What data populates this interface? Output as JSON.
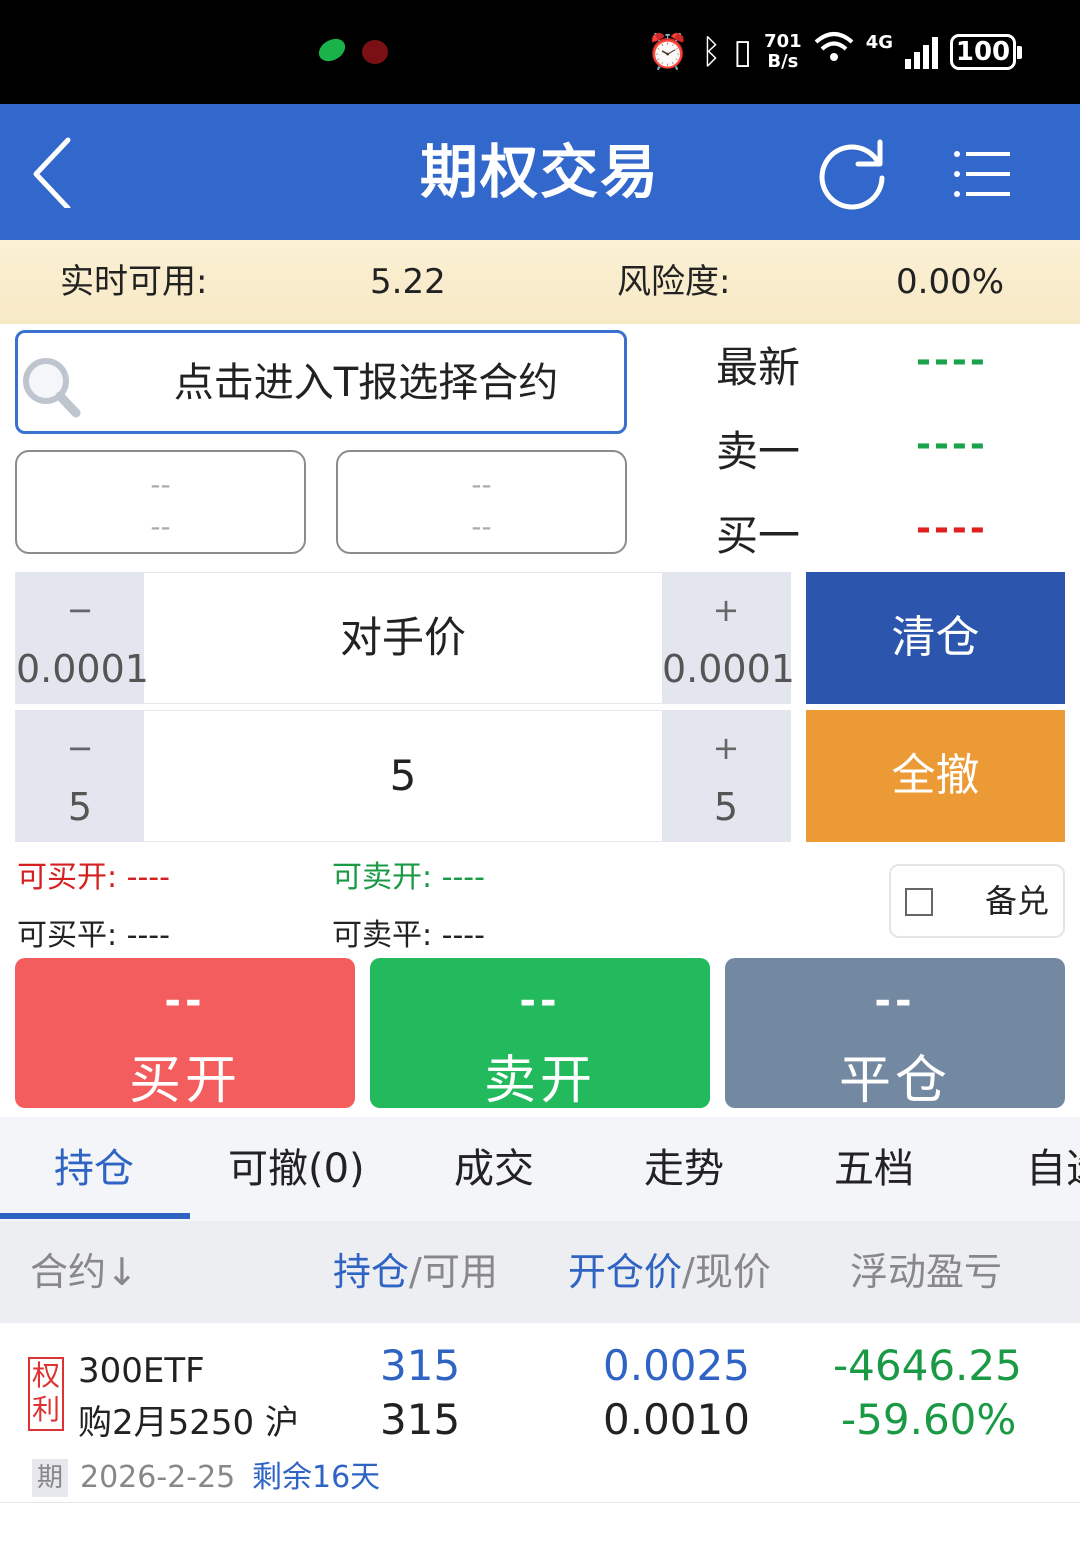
{
  "status_bar": {
    "net_speed_value": "701",
    "net_speed_unit": "B/s",
    "network_type": "4G",
    "battery": "100"
  },
  "header": {
    "title": "期权交易"
  },
  "account": {
    "available_label": "实时可用:",
    "available_value": "5.22",
    "risk_label": "风险度:",
    "risk_value": "0.00%"
  },
  "contract_search": {
    "label": "点击进入T报选择合约"
  },
  "dropdowns": [
    {
      "line1": "--",
      "line2": "--"
    },
    {
      "line1": "--",
      "line2": "--"
    }
  ],
  "quotes": [
    {
      "label": "最新",
      "value": "----",
      "color": "#1aa34a"
    },
    {
      "label": "卖一",
      "value": "----",
      "color": "#1aa34a"
    },
    {
      "label": "买一",
      "value": "----",
      "color": "#e02020"
    }
  ],
  "price_stepper": {
    "minus_sign": "−",
    "minus_amount": "0.0001",
    "center": "对手价",
    "plus_sign": "+",
    "plus_amount": "0.0001"
  },
  "qty_stepper": {
    "minus_sign": "−",
    "minus_amount": "5",
    "center": "5",
    "plus_sign": "+",
    "plus_amount": "5"
  },
  "actions": {
    "close_all": "清仓",
    "cancel_all": "全撤"
  },
  "availability": {
    "buy_open": "可买开: ----",
    "sell_open": "可卖开: ----",
    "buy_close": "可买平: ----",
    "sell_close": "可卖平: ----"
  },
  "covered": {
    "label": "备兑",
    "checked": false
  },
  "trade_buttons": [
    {
      "price": "--",
      "label": "买开",
      "color": "#f45d5d"
    },
    {
      "price": "--",
      "label": "卖开",
      "color": "#22ba5d"
    },
    {
      "price": "--",
      "label": "平仓",
      "color": "#7389a1"
    }
  ],
  "tabs": [
    "持仓",
    "可撤(0)",
    "成交",
    "走势",
    "五档",
    "自选"
  ],
  "active_tab": "持仓",
  "table_header": {
    "contract": "合约↓",
    "position_a": "持仓",
    "position_b": "/可用",
    "price_a": "开仓价",
    "price_b": "/现价",
    "pnl": "浮动盈亏"
  },
  "positions": [
    {
      "tag": "权利",
      "name_line1": "300ETF",
      "name_line2": "购2月5250 沪",
      "holding": "315",
      "available": "315",
      "open_price": "0.0025",
      "current_price": "0.0010",
      "pnl": "-4646.25",
      "pnl_pct": "-59.60%",
      "expiry_tag": "期",
      "expiry_date": "2026-2-25",
      "days_left": "剩余16天"
    }
  ]
}
